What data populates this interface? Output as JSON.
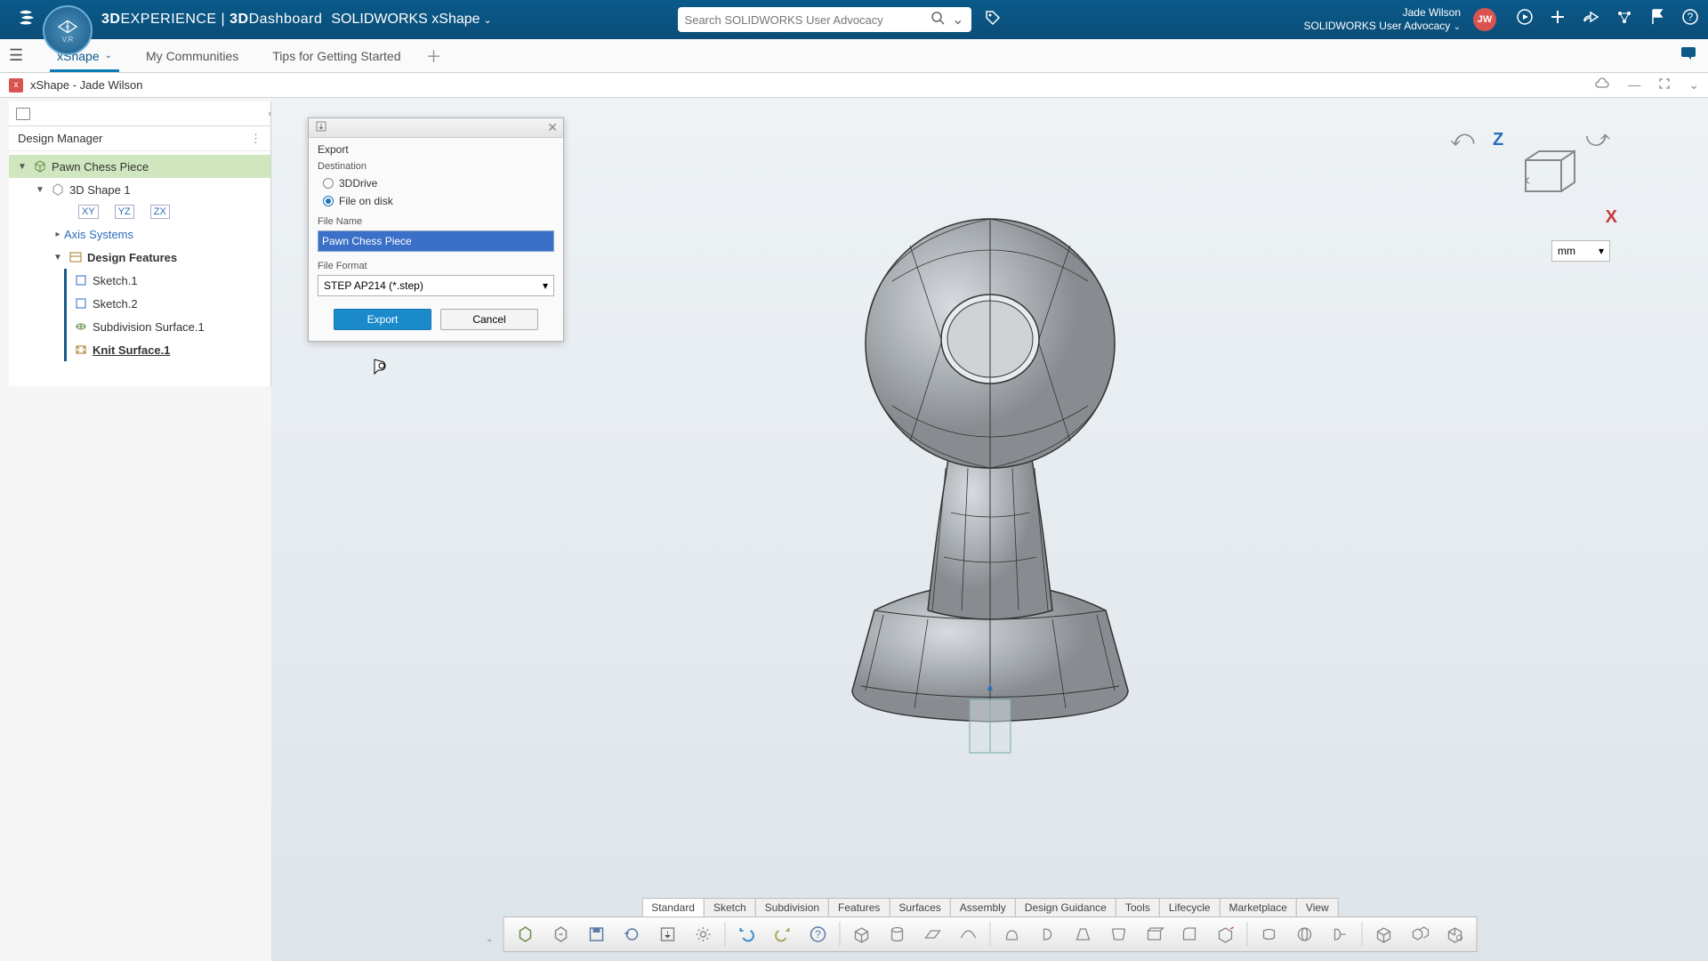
{
  "header": {
    "brand_a": "3D",
    "brand_b": "EXPERIENCE",
    "brand_divider": " | ",
    "brand_c": "3D",
    "brand_d": "Dashboard",
    "app": "SOLIDWORKS xShape",
    "search_placeholder": "Search SOLIDWORKS User Advocacy",
    "user_name": "Jade Wilson",
    "user_org": "SOLIDWORKS User Advocacy",
    "avatar": "JW"
  },
  "tabs": {
    "items": [
      "xShape",
      "My Communities",
      "Tips for Getting Started"
    ],
    "active_index": 0
  },
  "doc": {
    "title": "xShape - Jade Wilson"
  },
  "tree": {
    "header": "Design Manager",
    "root": "Pawn Chess Piece",
    "shape": "3D Shape 1",
    "axis": "Axis Systems",
    "features_label": "Design Features",
    "features": [
      "Sketch.1",
      "Sketch.2",
      "Subdivision Surface.1",
      "Knit Surface.1"
    ]
  },
  "export_dialog": {
    "title": "Export",
    "destination_label": "Destination",
    "dest_3ddrive": "3DDrive",
    "dest_file": "File on disk",
    "filename_label": "File Name",
    "filename_value": "Pawn Chess Piece",
    "format_label": "File Format",
    "format_value": "STEP AP214 (*.step)",
    "export_btn": "Export",
    "cancel_btn": "Cancel"
  },
  "viewport": {
    "axis_z": "Z",
    "axis_x": "X",
    "unit": "mm"
  },
  "bottom_tabs": [
    "Standard",
    "Sketch",
    "Subdivision",
    "Features",
    "Surfaces",
    "Assembly",
    "Design Guidance",
    "Tools",
    "Lifecycle",
    "Marketplace",
    "View"
  ],
  "bottom_active": 0,
  "colors": {
    "header_bg": "#0b5a8a",
    "accent": "#1a8acb",
    "tree_sel": "#cfe6bf"
  }
}
